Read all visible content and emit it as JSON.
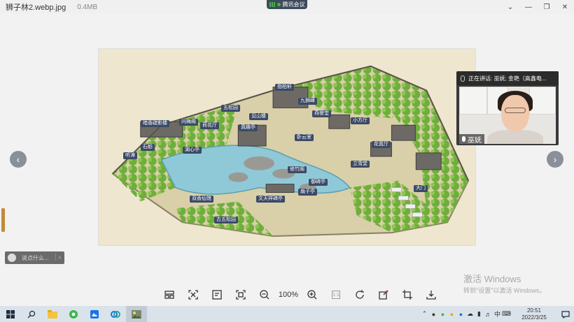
{
  "title_bar": {
    "file_name": "狮子林2.webp.jpg",
    "file_size": "0.4MB",
    "meeting_label": "腾讯会议"
  },
  "map": {
    "labels": [
      "指柏轩",
      "五松园",
      "九狮峰",
      "见山楼",
      "燕誉堂",
      "卧云室",
      "小方厅",
      "问梅阁",
      "荷花厅",
      "真趣亭",
      "石舫",
      "暗香疏影楼",
      "湖心亭",
      "立雪堂",
      "修竹阁",
      "扇子亭",
      "文天祥碑亭",
      "双香仙馆",
      "古五松园",
      "御碑亭",
      "大门",
      "花篮厅",
      "听涛"
    ]
  },
  "video": {
    "speaking_text": "正在讲话: 巫妩; 金艳（高鑫电...",
    "participant_name": "巫妩"
  },
  "chat": {
    "placeholder": "说点什么..."
  },
  "toolbar": {
    "zoom": "100%",
    "one_to_one": "1:1"
  },
  "watermark": {
    "line1": "激活 Windows",
    "line2": "转到\"设置\"以激活 Windows。"
  },
  "taskbar": {
    "time": "20:51",
    "date": "2022/3/25",
    "ime": "中"
  },
  "colors": {
    "meeting_green": "#4caf50",
    "taskbar": "#dbe3ea"
  }
}
